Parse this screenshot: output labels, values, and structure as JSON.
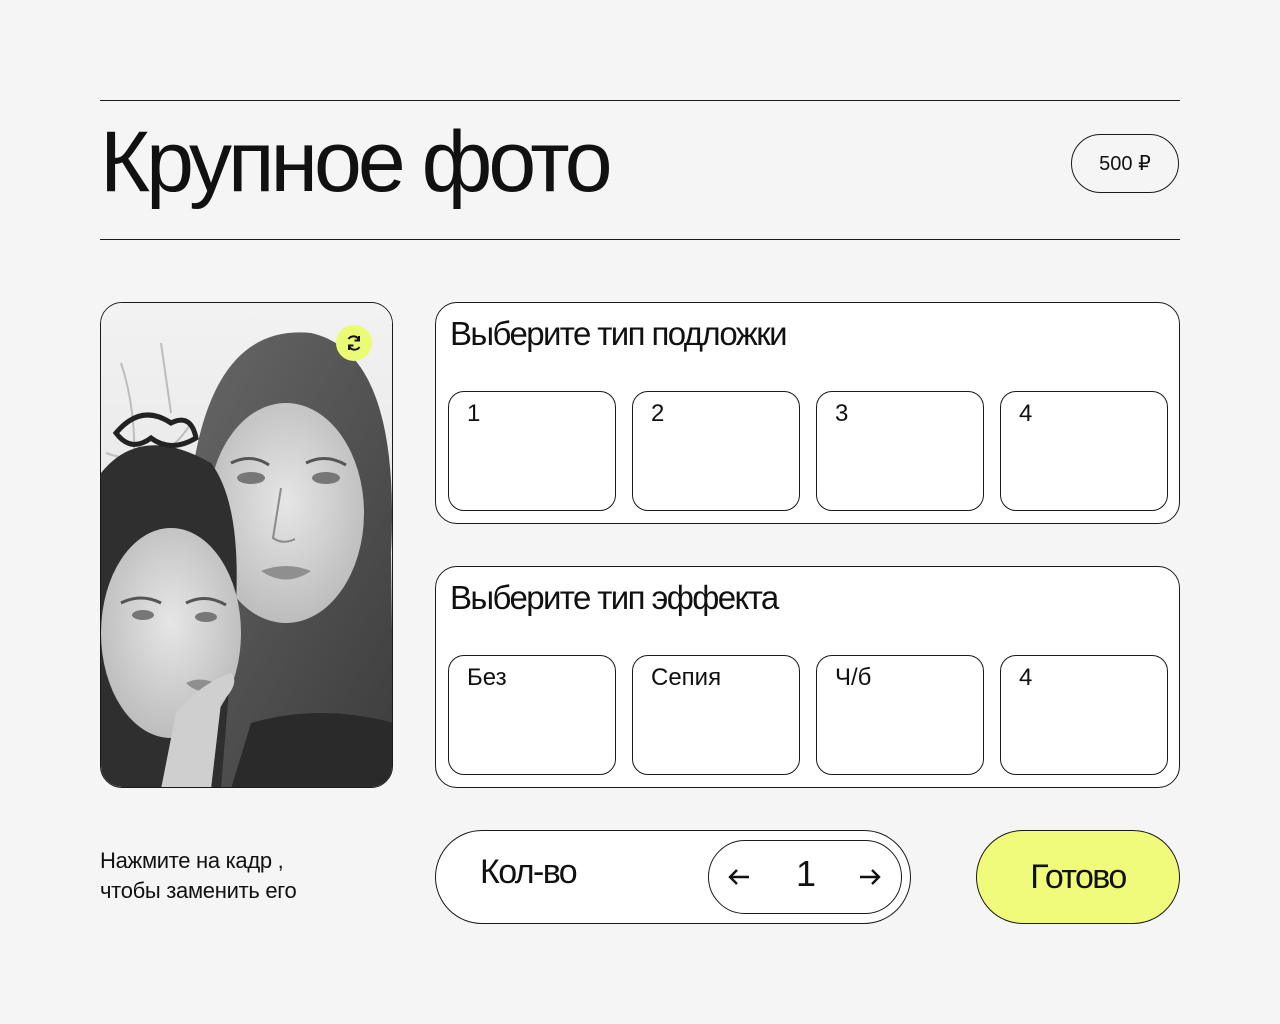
{
  "header": {
    "title": "Крупное фото",
    "price": "500 ₽"
  },
  "photo": {
    "alt_content": "photo-frame",
    "swap_icon": "refresh-icon",
    "accent_color": "#ecfb74"
  },
  "backing": {
    "title": "Выберите тип подложки",
    "options": [
      {
        "label": "1"
      },
      {
        "label": "2"
      },
      {
        "label": "3"
      },
      {
        "label": "4"
      }
    ]
  },
  "effect": {
    "title": "Выберите тип эффекта",
    "options": [
      {
        "label": "Без"
      },
      {
        "label": "Сепия"
      },
      {
        "label": "Ч/б"
      },
      {
        "label": "4"
      }
    ]
  },
  "hint": {
    "line1": "Нажмите на кадр ,",
    "line2": "чтобы заменить его"
  },
  "quantity": {
    "label": "Кол-во",
    "value": "1",
    "dec_icon": "arrow-left-icon",
    "inc_icon": "arrow-right-icon"
  },
  "actions": {
    "done_label": "Готово",
    "done_color": "#f1fb7b"
  }
}
